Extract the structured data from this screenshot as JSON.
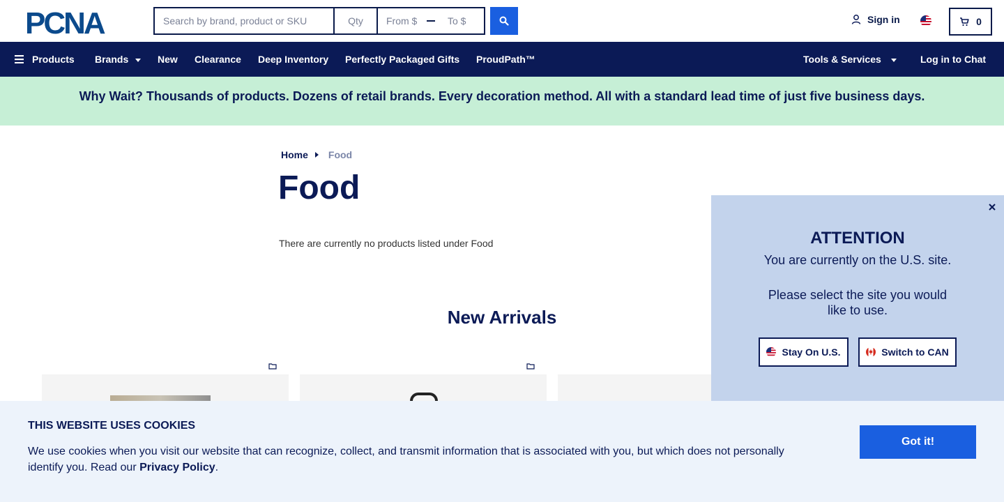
{
  "header": {
    "logo_text": "PCNA",
    "search": {
      "placeholder": "Search by brand, product or SKU",
      "qty_placeholder": "Qty",
      "from_placeholder": "From $",
      "to_placeholder": "To $"
    },
    "sign_in": "Sign in",
    "cart_count": "0"
  },
  "nav": {
    "products": "Products",
    "brands": "Brands",
    "new": "New",
    "clearance": "Clearance",
    "deep_inventory": "Deep Inventory",
    "packaged_gifts": "Perfectly Packaged Gifts",
    "proudpath": "ProudPath™",
    "tools": "Tools & Services",
    "chat": "Log in to Chat"
  },
  "banner": {
    "text": "Why Wait? Thousands of products. Dozens of retail brands. Every decoration method. All with a standard lead time of just five business days."
  },
  "breadcrumb": {
    "home": "Home",
    "current": "Food"
  },
  "main": {
    "title": "Food",
    "empty_message": "There are currently no products listed under Food",
    "new_arrivals": "New Arrivals"
  },
  "attention": {
    "title": "ATTENTION",
    "line1": "You are currently on the U.S. site.",
    "line2": "Please select the site you would like to use.",
    "stay_us": "Stay On U.S.",
    "switch_can": "Switch to CAN"
  },
  "cookie": {
    "title": "THIS WEBSITE USES COOKIES",
    "text": "We use cookies when you visit our website that can recognize, collect, and transmit information that is associated with you, but which does not personally identify you. Read our ",
    "link": "Privacy Policy",
    "period": ".",
    "button": "Got it!"
  },
  "colors": {
    "navy": "#0b1a56",
    "blue": "#1a5fe0",
    "banner": "#c6efd6",
    "panel": "#c3d3ec"
  }
}
